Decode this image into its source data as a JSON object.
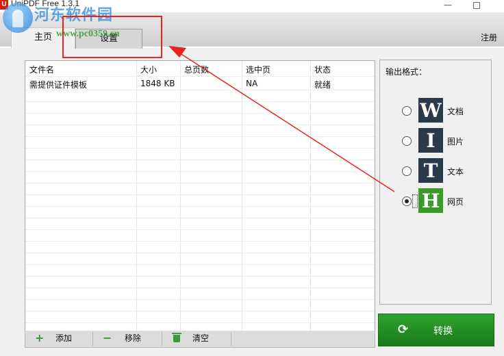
{
  "window": {
    "title": "UniPDF Free 1.3.1",
    "app_icon_letter": "U",
    "minimize_glyph": "—"
  },
  "header": {
    "register_label": "注册"
  },
  "watermark": {
    "site_name": "河东软件园",
    "url": "www.pc0359.cn"
  },
  "tabs": [
    {
      "label": "主页",
      "active": true
    },
    {
      "label": "设置",
      "active": false
    }
  ],
  "file_table": {
    "columns": [
      "文件名",
      "大小",
      "总页数",
      "选中页",
      "状态"
    ],
    "rows": [
      {
        "name": "需提供证件模板",
        "size": "1848 KB",
        "pages": "",
        "selected": "NA",
        "status": "就绪"
      }
    ]
  },
  "list_toolbar": {
    "add_label": "添加",
    "remove_label": "移除",
    "clear_label": "清空",
    "add_icon": "plus-icon",
    "remove_icon": "minus-icon",
    "clear_icon": "trash-icon"
  },
  "output_format": {
    "title": "输出格式：",
    "options": [
      {
        "letter": "W",
        "label": "文档",
        "color": "#2b3a4a",
        "selected": false
      },
      {
        "letter": "I",
        "label": "图片",
        "color": "#2b3a4a",
        "selected": false
      },
      {
        "letter": "T",
        "label": "文本",
        "color": "#2b3a4a",
        "selected": false
      },
      {
        "letter": "H",
        "label": "网页",
        "color": "#3c9a2b",
        "selected": true
      }
    ]
  },
  "convert": {
    "label": "转换",
    "icon": "refresh-icon"
  },
  "colors": {
    "accent_green": "#2e9b2e",
    "annotation_red": "#e8231b"
  }
}
